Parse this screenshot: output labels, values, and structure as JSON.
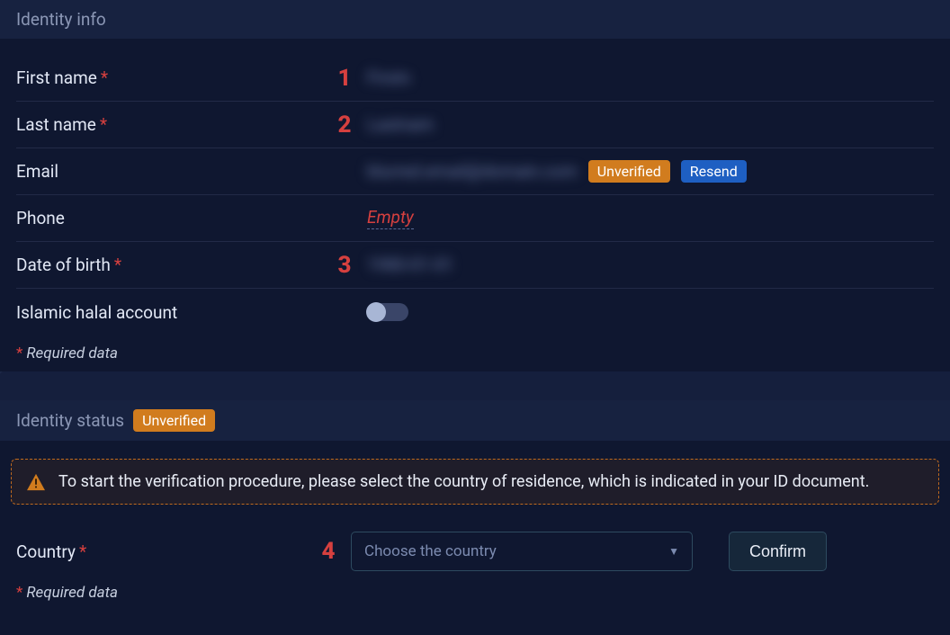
{
  "identity_info": {
    "title": "Identity info",
    "fields": {
      "first_name": {
        "label": "First name",
        "marker": "1",
        "value": "Firstn"
      },
      "last_name": {
        "label": "Last name",
        "marker": "2",
        "value": "Lastnam"
      },
      "email": {
        "label": "Email",
        "value": "blurred.email@domain.com"
      },
      "phone": {
        "label": "Phone",
        "empty_text": "Empty"
      },
      "dob": {
        "label": "Date of birth",
        "marker": "3",
        "value": "1980-01-01"
      },
      "halal": {
        "label": "Islamic halal account"
      }
    },
    "email_badges": {
      "unverified": "Unverified",
      "resend": "Resend"
    },
    "required_note": "Required data"
  },
  "identity_status": {
    "title": "Identity status",
    "badge": "Unverified",
    "alert": "To start the verification procedure, please select the country of residence, which is indicated in your ID document.",
    "country": {
      "label": "Country",
      "placeholder": "Choose the country",
      "marker": "4",
      "confirm": "Confirm"
    },
    "required_note": "Required data"
  }
}
